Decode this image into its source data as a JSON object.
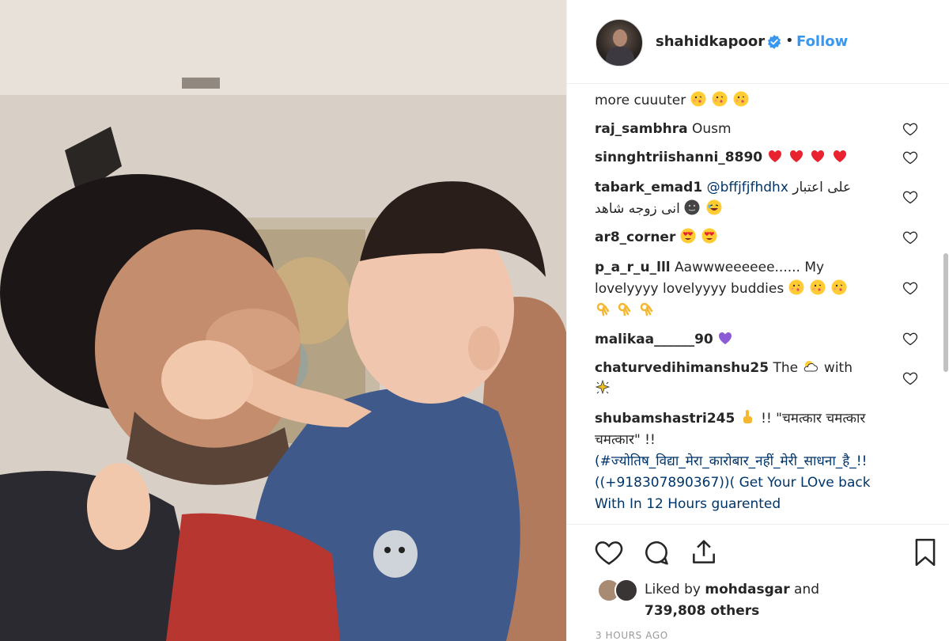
{
  "post": {
    "username": "shahidkapoor",
    "separator": "•",
    "follow_label": "Follow"
  },
  "comments": [
    {
      "user": "",
      "text": "more cuuuter",
      "emojis": [
        "kiss",
        "kiss",
        "kiss"
      ]
    },
    {
      "user": "raj_sambhra",
      "text": "Ousm"
    },
    {
      "user": "sinnghtriishanni_8890",
      "text": "",
      "emojis": [
        "red-heart",
        "red-heart",
        "red-heart",
        "red-heart"
      ]
    },
    {
      "user": "tabark_emad1",
      "mention": "@bffjfjfhdhx",
      "text": "على اعتبار",
      "text2": "انى زوجه شاهد"
    },
    {
      "user": "ar8_corner",
      "text": "",
      "emojis": [
        "heart-eyes",
        "heart-eyes"
      ]
    },
    {
      "user": "p_a_r_u_lll",
      "text": "Aawwweeeeee...... My lovelyyyy lovelyyyy buddies"
    },
    {
      "user": "malikaa______90",
      "text": ""
    },
    {
      "user": "chaturvedihimanshu25",
      "text": "The",
      "text2": "with"
    },
    {
      "user": "shubamshastri245",
      "text": "!! \"चमत्कार चमत्कार चमत्कार\" !!",
      "text2": "(#ज्योतिष_विद्या_मेरा_कारोबार_नहीं_मेरी_साधना_है_!!((+918307890367))( Get Your LOve back With In 12 Hours guarented"
    }
  ],
  "likes": {
    "liked_by_prefix": "Liked by",
    "liked_by_user": "mohdasgar",
    "and": "and",
    "others": "739,808 others"
  },
  "timestamp": "3 HOURS AGO",
  "icons": {
    "verified": "verified-badge-icon",
    "like": "heart-icon",
    "comment": "comment-icon",
    "share": "share-icon",
    "save": "bookmark-icon"
  },
  "colors": {
    "link": "#3897f0",
    "text": "#262626",
    "muted": "#999999"
  }
}
